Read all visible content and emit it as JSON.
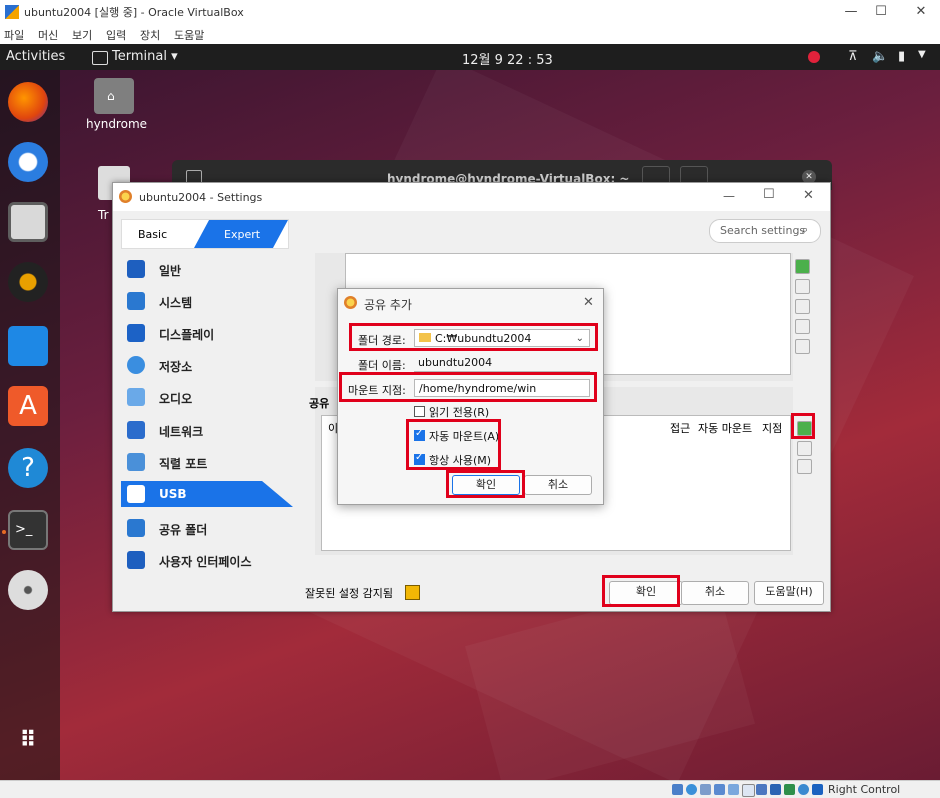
{
  "host": {
    "title": "ubuntu2004 [실행 중] - Oracle VirtualBox",
    "menu": [
      "파일",
      "머신",
      "보기",
      "입력",
      "장치",
      "도움말"
    ],
    "status_right": "Right Control"
  },
  "topbar": {
    "activities": "Activities",
    "app": "Terminal ▾",
    "clock": "12월 9  22 : 53"
  },
  "desktop": {
    "home_label": "hyndrome",
    "trash_label": "Tr"
  },
  "terminal": {
    "title": "hyndrome@hyndrome-VirtualBox: ~"
  },
  "settings": {
    "title": "ubuntu2004 - Settings",
    "mode_basic": "Basic",
    "mode_expert": "Expert",
    "search_placeholder": "Search settings",
    "nav": [
      {
        "label": "일반",
        "icon": "general-icon"
      },
      {
        "label": "시스템",
        "icon": "system-icon"
      },
      {
        "label": "디스플레이",
        "icon": "display-icon"
      },
      {
        "label": "저장소",
        "icon": "storage-icon"
      },
      {
        "label": "오디오",
        "icon": "audio-icon"
      },
      {
        "label": "네트워크",
        "icon": "network-icon"
      },
      {
        "label": "직렬 포트",
        "icon": "serial-port-icon"
      },
      {
        "label": "USB",
        "icon": "usb-icon"
      },
      {
        "label": "공유 폴더",
        "icon": "shared-folder-icon"
      },
      {
        "label": "사용자 인터페이스",
        "icon": "user-interface-icon"
      }
    ],
    "selected_nav": "USB",
    "section_label": "공유",
    "table_col_first": "이",
    "table_headers": [
      "접근",
      "자동 마운트",
      "지점"
    ],
    "invalid_settings": "잘못된 설정 감지됨",
    "ok": "확인",
    "cancel": "취소",
    "help": "도움말(H)"
  },
  "add_share": {
    "title": "공유 추가",
    "folder_path_label": "폴더 경로:",
    "folder_path_value": "C:₩ubundtu2004",
    "folder_name_label": "폴더 이름:",
    "folder_name_value": "ubundtu2004",
    "mount_point_label": "마운트 지점:",
    "mount_point_value": "/home/hyndrome/win",
    "readonly_label": "읽기 전용(R)",
    "readonly_checked": false,
    "automount_label": "자동 마운트(A)",
    "automount_checked": true,
    "permanent_label": "항상 사용(M)",
    "permanent_checked": true,
    "ok": "확인",
    "cancel": "취소"
  }
}
